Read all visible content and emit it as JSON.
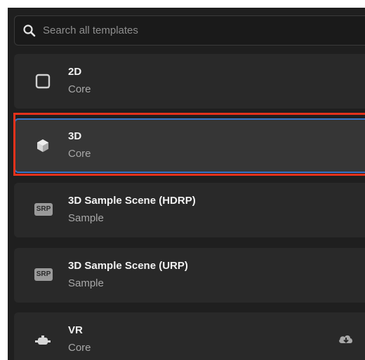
{
  "search": {
    "placeholder": "Search all templates",
    "icon": "search-icon"
  },
  "templates": [
    {
      "name": "2D",
      "category": "Core",
      "icon": "square-icon",
      "selected": false
    },
    {
      "name": "3D",
      "category": "Core",
      "icon": "cube-icon",
      "selected": true
    },
    {
      "name": "3D Sample Scene (HDRP)",
      "category": "Sample",
      "icon": "srp-icon",
      "badge": "SRP",
      "selected": false
    },
    {
      "name": "3D Sample Scene (URP)",
      "category": "Sample",
      "icon": "srp-icon",
      "badge": "SRP",
      "selected": false
    },
    {
      "name": "VR",
      "category": "Core",
      "icon": "vr-headset-icon",
      "action_icon": "cloud-download-icon",
      "selected": false
    }
  ],
  "colors": {
    "background": "#1f1f1f",
    "card": "#292929",
    "card_selected": "#363636",
    "selection_border": "#3b75c8",
    "highlight": "#e5321b"
  }
}
